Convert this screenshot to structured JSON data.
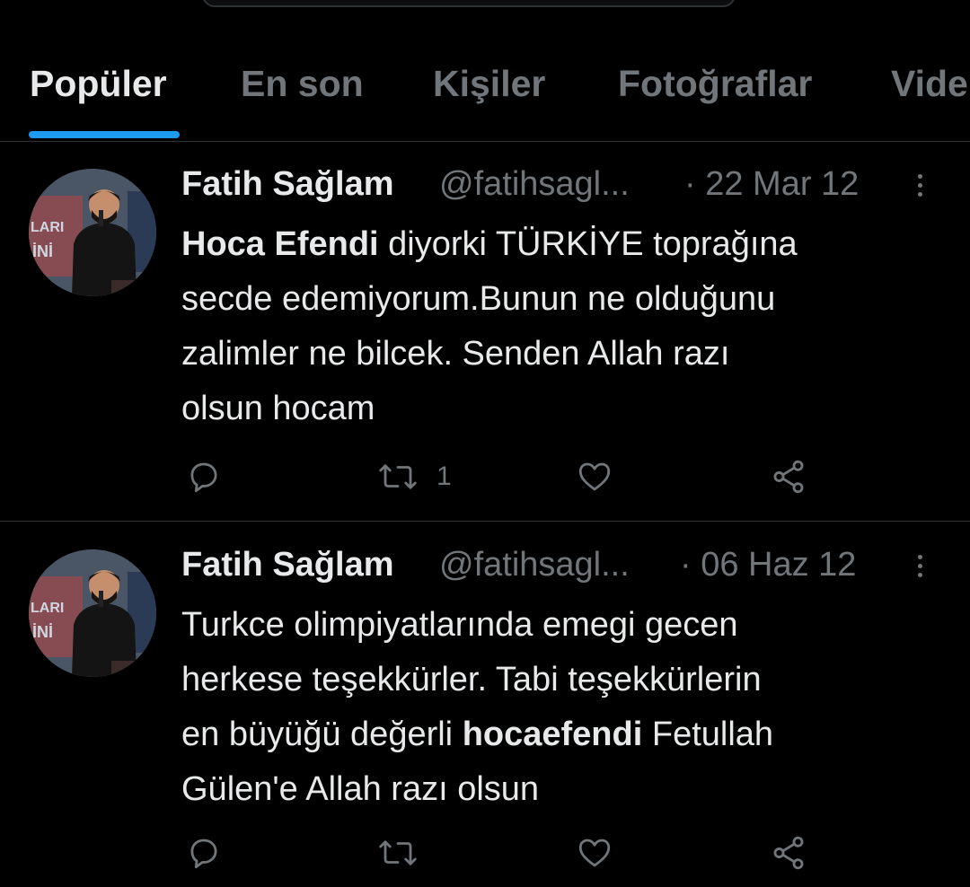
{
  "tabs": [
    {
      "label": "Popüler",
      "active": true
    },
    {
      "label": "En son",
      "active": false
    },
    {
      "label": "Kişiler",
      "active": false
    },
    {
      "label": "Fotoğraflar",
      "active": false
    },
    {
      "label": "Vide",
      "active": false
    }
  ],
  "colors": {
    "background": "#000000",
    "text_primary": "#e7e9ea",
    "text_secondary": "#71767b",
    "accent": "#1d9bf0",
    "divider": "#2f3336"
  },
  "tweets": [
    {
      "name": "Fatih Sağlam",
      "handle": "@fatihsagl...",
      "date": "· 22 Mar 12",
      "body": [
        [
          {
            "text": "Hoca Efendi",
            "bold": true
          },
          {
            "text": " diyorki TÜRKİYE toprağına",
            "bold": false
          }
        ],
        [
          {
            "text": "secde edemiyorum.Bunun ne olduğunu",
            "bold": false
          }
        ],
        [
          {
            "text": "zalimler ne bilcek. Senden Allah razı",
            "bold": false
          }
        ],
        [
          {
            "text": "olsun hocam",
            "bold": false
          }
        ]
      ],
      "retweet_count": "1",
      "icons": [
        "reply-icon",
        "retweet-icon",
        "like-icon",
        "share-icon"
      ]
    },
    {
      "name": "Fatih Sağlam",
      "handle": "@fatihsagl...",
      "date": "· 06 Haz 12",
      "body": [
        [
          {
            "text": "Turkce olimpiyatlarında emegi gecen",
            "bold": false
          }
        ],
        [
          {
            "text": "herkese teşekkürler. Tabi teşekkürlerin",
            "bold": false
          }
        ],
        [
          {
            "text": "en büyüğü değerli ",
            "bold": false
          },
          {
            "text": "hocaefendi",
            "bold": true
          },
          {
            "text": " Fetullah",
            "bold": false
          }
        ],
        [
          {
            "text": "Gülen'e Allah razı olsun",
            "bold": false
          }
        ]
      ],
      "retweet_count": "",
      "icons": [
        "reply-icon",
        "retweet-icon",
        "like-icon",
        "share-icon"
      ]
    }
  ]
}
